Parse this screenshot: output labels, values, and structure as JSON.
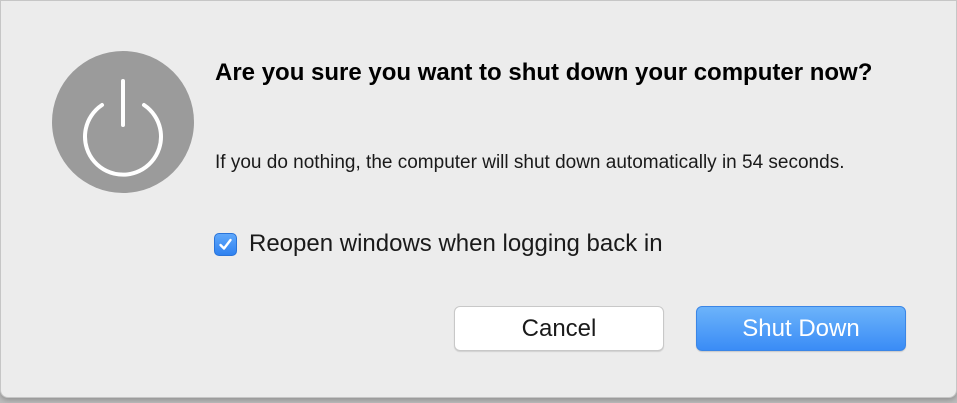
{
  "dialog": {
    "icon": "power-icon",
    "title": "Are you sure you want to shut down your computer now?",
    "message": "If you do nothing, the computer will shut down automatically in 54 seconds.",
    "checkbox": {
      "label": "Reopen windows when logging back in",
      "checked": true
    },
    "buttons": {
      "cancel_label": "Cancel",
      "primary_label": "Shut Down"
    }
  },
  "colors": {
    "accent": "#3a8cf6",
    "dialog_background": "#ececec",
    "icon_background": "#9b9b9b"
  }
}
